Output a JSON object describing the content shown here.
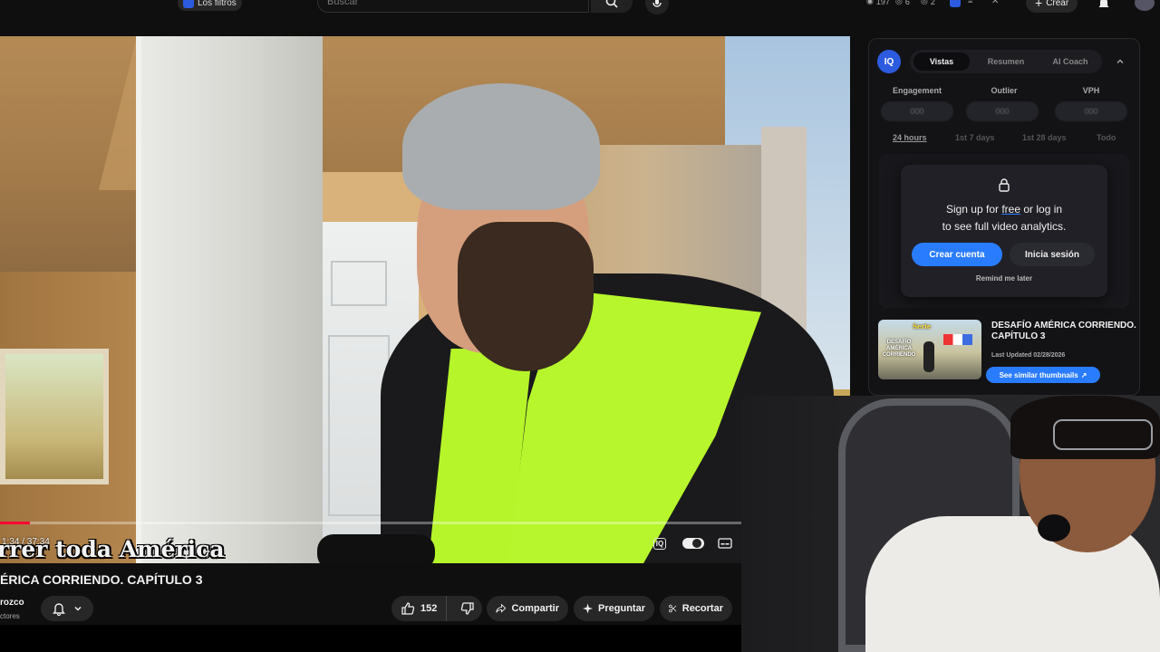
{
  "topbar": {
    "filter_chip": "Los filtros",
    "search_placeholder": "Buscar",
    "stats": [
      "197",
      "6",
      "2"
    ],
    "create_label": "Crear"
  },
  "video": {
    "subtitle": "rrer toda América",
    "current_time": "1:34 / 37:34",
    "progress_fraction": 0.04
  },
  "info": {
    "title": "ÉRICA CORRIENDO. CAPÍTULO 3",
    "channel": "rozco",
    "subscribers": "ctores",
    "like_count": "152",
    "share_label": "Compartir",
    "ask_label": "Preguntar",
    "clip_label": "Recortar"
  },
  "panel": {
    "logo": "IQ",
    "tabs": [
      "Vistas",
      "Resumen",
      "AI Coach"
    ],
    "metrics": [
      {
        "label": "Engagement",
        "value": "000"
      },
      {
        "label": "Outlier",
        "value": "000"
      },
      {
        "label": "VPH",
        "value": "000"
      }
    ],
    "ranges": [
      "24 hours",
      "1st 7 days",
      "1st 28 days",
      "Todo"
    ],
    "overlay": {
      "line1_a": "Sign up for ",
      "line1_free": "free",
      "line1_b": " or log in",
      "line2": "to see full video analytics.",
      "create_button": "Crear cuenta",
      "login_button": "Inicia sesión",
      "remind": "Remind me later"
    },
    "thumb": {
      "tag": "Serie",
      "overlay_text": "DESAFÍO AMÉRICA CORRIENDO",
      "title": "DESAFÍO AMÉRICA CORRIENDO. CAPÍTULO 3",
      "updated": "Last Updated 02/28/2026",
      "similar_button": "See similar thumbnails"
    }
  },
  "colors": {
    "accent": "#2a7cff",
    "progress": "#ff0033",
    "vest": "#b7f62c"
  }
}
